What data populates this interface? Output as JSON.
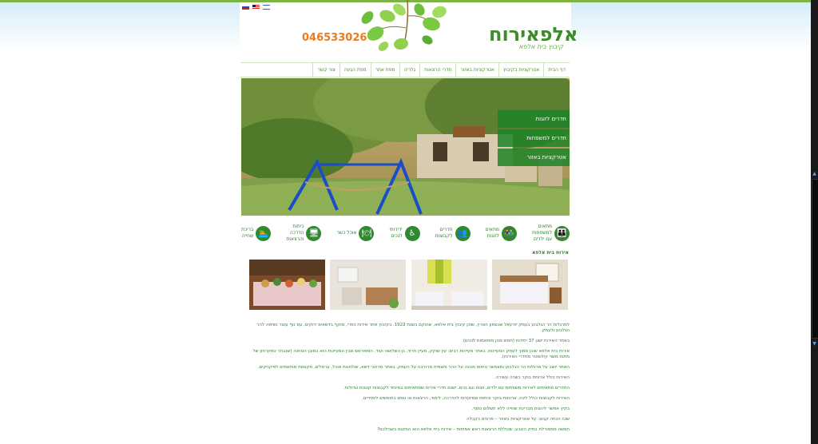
{
  "header": {
    "logo_title": "אלפאירוח",
    "logo_subtitle": "קיבוץ בית אלפא",
    "phone": "046533026"
  },
  "flags": [
    "russian-flag-icon",
    "us-flag-icon",
    "israel-flag-icon"
  ],
  "nav": {
    "items": [
      "דף הבית",
      "אטרקציות בקיבוץ",
      "אטרקציות באזור",
      "חדרי הרצאות",
      "גלריה",
      "מפת אתר",
      "מפת הגעה",
      "צור קשר"
    ]
  },
  "hero_menu": {
    "items": [
      "חדרים לזוגות",
      "חדרים למשפחות",
      "אטרקציות באזור"
    ]
  },
  "features": [
    {
      "text": "מתאים\nלמשפחות\nעם ילדים",
      "icon": "family-icon",
      "glyph": "👪"
    },
    {
      "text": "מתאים\nלזוגות",
      "icon": "couple-icon",
      "glyph": "👫"
    },
    {
      "text": "חדרים\nלקבוצות",
      "icon": "group-icon",
      "glyph": "👥"
    },
    {
      "text": "ידידותי\nלנכים",
      "icon": "wheelchair-icon",
      "glyph": "♿"
    },
    {
      "text": "אוכל כשר",
      "icon": "food-icon",
      "glyph": "🍽"
    },
    {
      "text": "כיתות\nהדרכה\nוהרצאות",
      "icon": "lecture-icon",
      "glyph": "🖥"
    },
    {
      "text": "בריכת\nשחייה",
      "icon": "swimming-icon",
      "glyph": "🏊"
    }
  ],
  "section": {
    "title": "אירוח בית אלפא"
  },
  "paragraphs": [
    "למרגלות הר הגלבוע בעמק יזרעאל שבצפון הארץ, שוכן קיבוץ בית אלפא, שהוקם בשנת 1922. בקיבוץ אתר אירוח כפרי, מוקף בדשאים ירוקים, עם נוף עוצר נשימה להר הגלבוע ולעמק.",
    "באתר האירוח ישנן 37 יחידות (חמש מהן מותאמות לנכים).",
    "אירוח בית אלפא שוכן סמוך לעמק המעיינות. באתר מעיינות רבים: עין שוקק, מעיין חרוד, גן השלושה ועוד. המפורסם מבין המעיינות הוא כמובן הסחנה (שנבחר כמקרחון של מתות משני קילומטר מחדרי האירוח).",
    "האתר יושב על מרגלות הר הגלבוע ומאפשר טיפוס מהנה על ההר ותצפית מרהיבה על העמק. באתר מרחבי דשא, שולחנות אוכל, ערסלים, מקומות מותאמים לפיקניקים.",
    "האירוח כולל ארוחת בוקר כשרה עשירה.",
    "החדרים מתאימים לאירוח משפחות עם ילדים, זוגות וגם נכים. ישנם חדרי אירוח שמתאימים במיוחד לקבוצות קטנות וגדולות.",
    "האירוח לקבוצות כולל לינה, ארוחות בוקר וכיתות שמיועדות להדרכה, לימוד, הרצאות או נופש בחופשים לימודיים.",
    "בקיץ אפשר ליהנות מבריכת שחייה ללא תשלום נוסף.",
    "שנה הנחה קבוצ: על אטרקציות באזור – פרטים בקבלה",
    "חפשה ממסורלת בחיק הטבע, שכוללת הרצאות ראש אמיתות – אירוח בית אלפא הוא המקום בשבילכם?"
  ],
  "colors": {
    "brand_green": "#3d8b2a",
    "phone_orange": "#f07a1a",
    "top_accent": "#7cb342"
  }
}
